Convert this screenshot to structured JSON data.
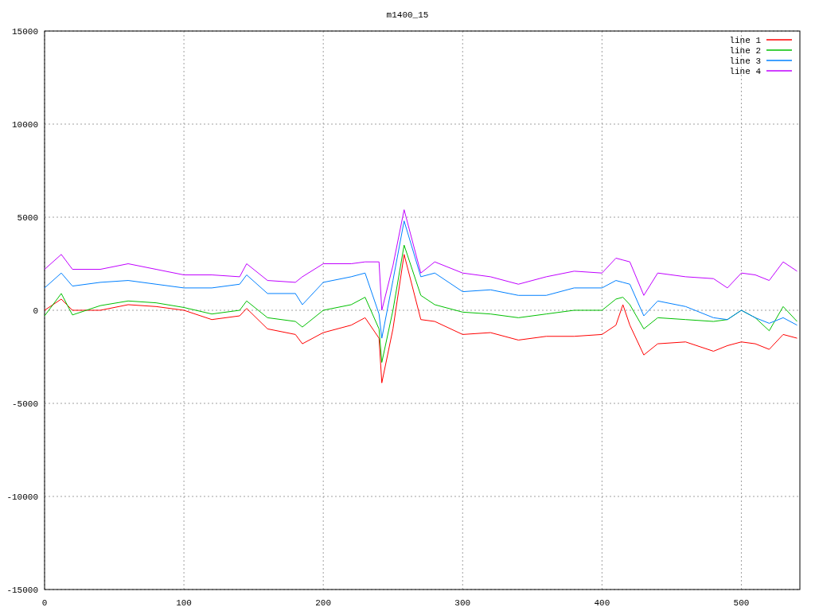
{
  "chart_data": {
    "type": "line",
    "title": "m1400_15",
    "grid": true,
    "legend": true,
    "x": [
      0,
      12,
      20,
      40,
      60,
      80,
      100,
      120,
      140,
      145,
      160,
      180,
      185,
      200,
      220,
      230,
      240,
      242,
      250,
      258,
      270,
      280,
      300,
      320,
      340,
      360,
      380,
      400,
      410,
      415,
      420,
      430,
      440,
      460,
      480,
      490,
      500,
      510,
      520,
      530,
      540
    ],
    "xlim": [
      0,
      542
    ],
    "ylim": [
      -15000,
      15000
    ],
    "xticks": [
      0,
      100,
      200,
      300,
      400,
      500
    ],
    "yticks": [
      -15000,
      -10000,
      -5000,
      0,
      5000,
      10000,
      15000
    ],
    "series": [
      {
        "name": "line 1",
        "color": "#ff0000",
        "values": [
          0,
          600,
          0,
          0,
          300,
          200,
          0,
          -500,
          -300,
          100,
          -1000,
          -1300,
          -1800,
          -1200,
          -800,
          -400,
          -1500,
          -3900,
          -1000,
          3000,
          -500,
          -600,
          -1300,
          -1200,
          -1600,
          -1400,
          -1400,
          -1300,
          -800,
          300,
          -800,
          -2400,
          -1800,
          -1700,
          -2200,
          -1900,
          -1700,
          -1800,
          -2100,
          -1300,
          -1500
        ]
      },
      {
        "name": "line 2",
        "color": "#00c000",
        "values": [
          -300,
          900,
          -250,
          250,
          500,
          400,
          150,
          -200,
          0,
          500,
          -400,
          -600,
          -900,
          0,
          300,
          700,
          -1000,
          -2800,
          0,
          3500,
          800,
          300,
          -100,
          -200,
          -400,
          -200,
          0,
          0,
          600,
          700,
          300,
          -1000,
          -400,
          -500,
          -600,
          -500,
          0,
          -400,
          -1100,
          200,
          -600
        ]
      },
      {
        "name": "line 3",
        "color": "#0080ff",
        "values": [
          1200,
          2000,
          1300,
          1500,
          1600,
          1400,
          1200,
          1200,
          1400,
          1900,
          900,
          900,
          300,
          1500,
          1800,
          2000,
          -200,
          -1500,
          1600,
          4800,
          1800,
          2000,
          1000,
          1100,
          800,
          800,
          1200,
          1200,
          1600,
          1500,
          1400,
          -300,
          500,
          200,
          -400,
          -500,
          0,
          -400,
          -700,
          -400,
          -800
        ]
      },
      {
        "name": "line 4",
        "color": "#c000ff",
        "values": [
          2200,
          3000,
          2200,
          2200,
          2500,
          2200,
          1900,
          1900,
          1800,
          2500,
          1600,
          1500,
          1800,
          2500,
          2500,
          2600,
          2600,
          0,
          2400,
          5400,
          2000,
          2600,
          2000,
          1800,
          1400,
          1800,
          2100,
          2000,
          2800,
          2700,
          2600,
          800,
          2000,
          1800,
          1700,
          1200,
          2000,
          1900,
          1600,
          2600,
          2100
        ]
      }
    ]
  }
}
